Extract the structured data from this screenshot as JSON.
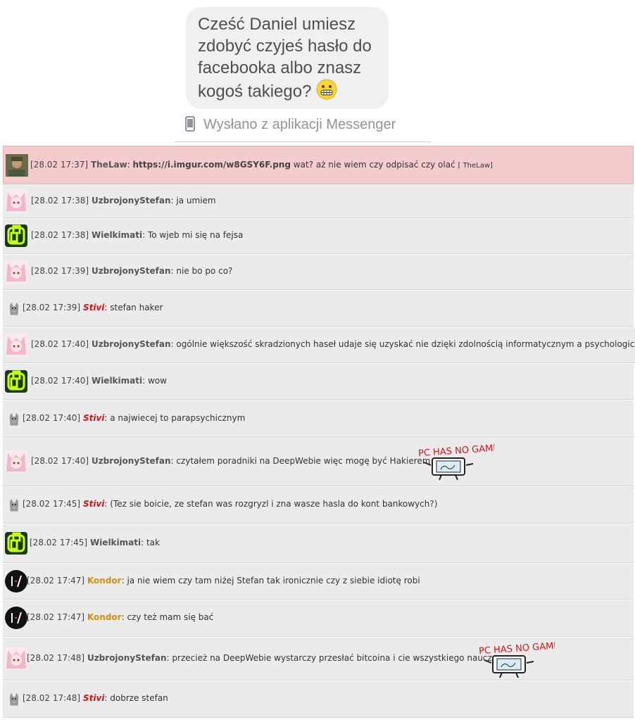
{
  "messenger": {
    "message_lines": [
      "Cześć Daniel umiesz",
      "zdobyć czyjeś hasło do",
      "facebooka albo znasz",
      "kogoś takiego?"
    ],
    "emoji": "grimacing-emoji-icon",
    "sent_label": "Wysłano z aplikacji Messenger",
    "sent_icon": "phone-icon"
  },
  "chat": {
    "messages": [
      {
        "time": "[28.02 17:37]",
        "nick": "TheLaw",
        "avatar": "soldier-avatar",
        "text": "wat? aż nie wiem czy odpisać czy olać",
        "link": "https://i.imgur.com/w8GSY6F.png",
        "tag": "[ TheLaw]",
        "highlight": true
      },
      {
        "time": "[28.02 17:38]",
        "nick": "UzbrojonyStefan",
        "avatar": "anime-girl-avatar",
        "text": "ja umiem"
      },
      {
        "time": "[28.02 17:38]",
        "nick": "Wielkimati",
        "avatar": "green-logo-avatar",
        "text": "To wjeb mi się na fejsa"
      },
      {
        "time": "[28.02 17:39]",
        "nick": "UzbrojonyStefan",
        "avatar": "anime-girl-avatar",
        "text": "nie bo po co?"
      },
      {
        "time": "[28.02 17:39]",
        "nick": "Stivi",
        "avatar": "wolf-avatar",
        "text": "stefan haker"
      },
      {
        "time": "[28.02 17:40]",
        "nick": "UzbrojonyStefan",
        "avatar": "anime-girl-avatar",
        "text": "ogólnie większość skradzionych haseł udaje się uzyskać nie dzięki zdolnością informatycznym a psychologicznym"
      },
      {
        "time": "[28.02 17:40]",
        "nick": "Wielkimati",
        "avatar": "green-logo-avatar",
        "text": "wow"
      },
      {
        "time": "[28.02 17:40]",
        "nick": "Stivi",
        "avatar": "wolf-avatar",
        "text": "a najwiecej to parapsychicznym"
      },
      {
        "time": "[28.02 17:40]",
        "nick": "UzbrojonyStefan",
        "avatar": "anime-girl-avatar",
        "text": "czytałem poradniki na DeepWebie więc mogę być Hakierem",
        "meme": "PC HAS NO GAME"
      },
      {
        "time": "[28.02 17:45]",
        "nick": "Stivi",
        "avatar": "wolf-avatar",
        "text": "(Tez sie boicie, ze stefan was rozgryzl i zna wasze hasla do kont bankowych?)"
      },
      {
        "time": "[28.02 17:45]",
        "nick": "Wielkimati",
        "avatar": "green-logo-avatar",
        "text": "tak"
      },
      {
        "time": "[28.02 17:47]",
        "nick": "Kondor",
        "avatar": "kondor-avatar",
        "text": "ja nie wiem czy tam niżej Stefan tak ironicznie czy z siebie idiotę robi"
      },
      {
        "time": "[28.02 17:47]",
        "nick": "Kondor",
        "avatar": "kondor-avatar",
        "text": "czy też mam się bać"
      },
      {
        "time": "[28.02 17:48]",
        "nick": "UzbrojonyStefan",
        "avatar": "anime-girl-avatar",
        "text": "przecież na DeepWebie wystarczy przesłać bitcoina i cie wszystkiego nauczą",
        "meme": "PC HAS NO GAME"
      },
      {
        "time": "[28.02 17:48]",
        "nick": "Stivi",
        "avatar": "wolf-avatar",
        "text": "dobrze stefan"
      }
    ]
  },
  "colors": {
    "highlight_row": "#f5cccd",
    "row": "#ebebeb",
    "stivi_nick": "#e01010",
    "kondor_nick": "#d28e10"
  }
}
